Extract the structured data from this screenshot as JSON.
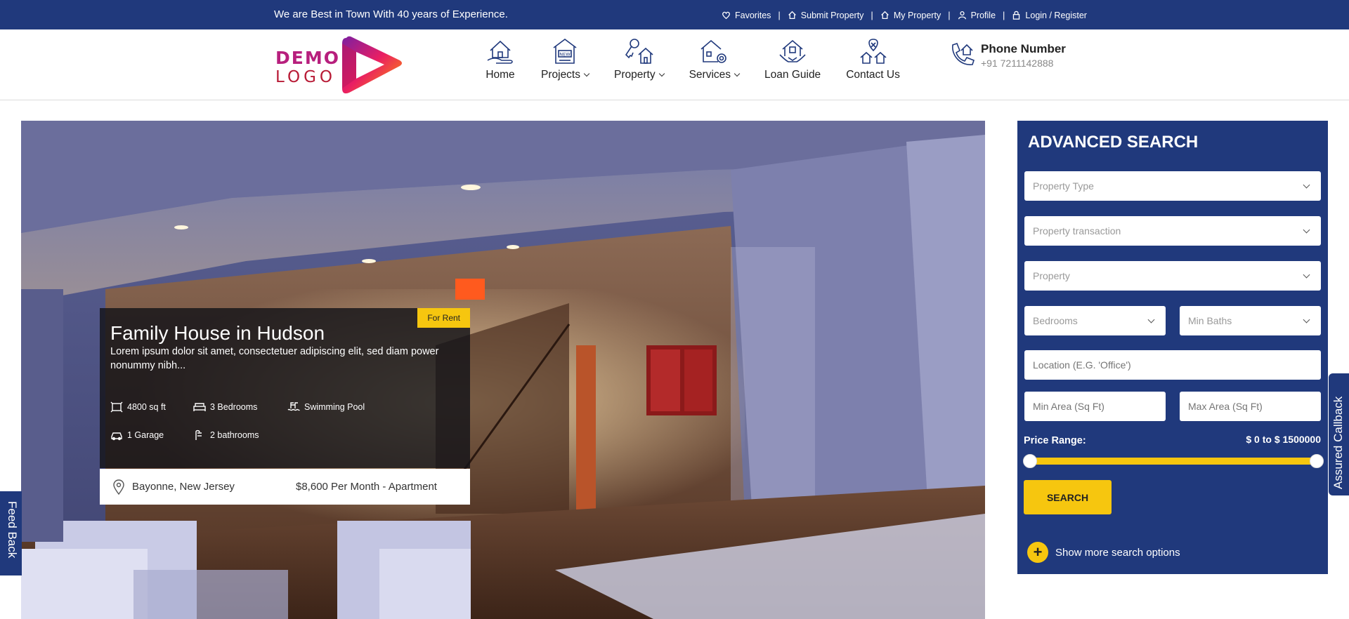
{
  "topbar": {
    "tagline": "We are Best in Town With 40 years of Experience.",
    "links": [
      {
        "label": "Favorites",
        "icon": "heart-icon"
      },
      {
        "label": "Submit Property",
        "icon": "home-icon"
      },
      {
        "label": "My Property",
        "icon": "home-icon"
      },
      {
        "label": "Profile",
        "icon": "user-icon"
      },
      {
        "label": "Login / Register",
        "icon": "lock-icon"
      }
    ]
  },
  "logo": {
    "line1": "DEMO",
    "line2": "LOGO"
  },
  "nav": [
    {
      "label": "Home",
      "icon": "house-hand-icon"
    },
    {
      "label": "Projects",
      "icon": "new-house-icon"
    },
    {
      "label": "Property",
      "icon": "key-house-icon"
    },
    {
      "label": "Services",
      "icon": "house-gear-icon"
    },
    {
      "label": "Loan Guide",
      "icon": "house-handshake-icon"
    },
    {
      "label": "Contact Us",
      "icon": "location-houses-icon"
    }
  ],
  "phone": {
    "title": "Phone Number",
    "number": "+91 7211142888",
    "icon": "phone-house-icon"
  },
  "listing": {
    "badge": "For Rent",
    "title": "Family House in Hudson",
    "description": "Lorem ipsum dolor sit amet, consectetuer adipiscing elit, sed diam power nonummy nibh...",
    "features": [
      {
        "label": "4800 sq ft",
        "icon": "area-icon"
      },
      {
        "label": "3 Bedrooms",
        "icon": "bed-icon"
      },
      {
        "label": "Swimming Pool",
        "icon": "pool-icon"
      },
      {
        "label": "1 Garage",
        "icon": "car-icon"
      },
      {
        "label": "2 bathrooms",
        "icon": "shower-icon"
      }
    ],
    "location": "Bayonne, New Jersey",
    "price": "$8,600 Per Month - Apartment"
  },
  "search": {
    "title": "ADVANCED SEARCH",
    "property_type": "Property Type",
    "property_transaction": "Property transaction",
    "property": "Property",
    "bedrooms": "Bedrooms",
    "min_baths": "Min Baths",
    "location_placeholder": "Location (E.G. 'Office')",
    "min_area_placeholder": "Min Area (Sq Ft)",
    "max_area_placeholder": "Max Area (Sq Ft)",
    "price_range_label": "Price Range:",
    "price_range_value": "$ 0 to $ 1500000",
    "price_min": 0,
    "price_max": 1500000,
    "search_button": "SEARCH",
    "more_options": "Show more search options",
    "more_icon": "+"
  },
  "side_tabs": {
    "right": "Assured Callback",
    "left": "Feed Back"
  },
  "colors": {
    "primary": "#20397c",
    "accent": "#f6c60f"
  }
}
